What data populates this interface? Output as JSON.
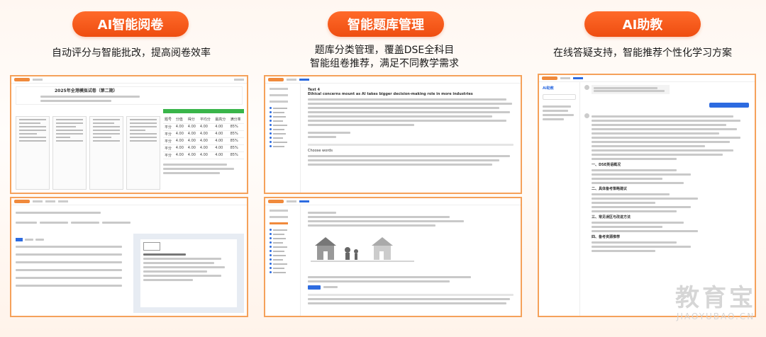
{
  "features": [
    {
      "title": "AI智能阅卷",
      "description": [
        "自动评分与智能批改，提高阅卷效率"
      ]
    },
    {
      "title": "智能题库管理",
      "description": [
        "题库分类管理，覆盖DSE全科目",
        "智能组卷推荐，满足不同教学需求"
      ]
    },
    {
      "title": "AI助教",
      "description": [
        "在线答疑支持，智能推荐个性化学习方案"
      ]
    }
  ],
  "screens": {
    "grading": {
      "exam_title": "2025年全港模拟试卷（第二期）",
      "table_headers": [
        "题号",
        "分值",
        "得分",
        "平均分",
        "最高分",
        "满分率"
      ],
      "row_label": "平分",
      "row_values": [
        "4.00",
        "4.00",
        "4.00",
        "4.00",
        "85%"
      ]
    },
    "question_bank": {
      "text_label": "Text 4",
      "heading": "Ethical concerns mount as AI takes bigger decision-making role in more industries",
      "question_type": "Choose words"
    },
    "assistant": {
      "title": "AI助教",
      "section_headers": [
        "一、DSE英语概况",
        "二、具体备考策略建议",
        "三、常见误区与改进方法",
        "四、备考资源推荐"
      ]
    }
  },
  "watermark": {
    "text": "教育宝",
    "domain": "JIAOYUBAO.CN"
  },
  "colors": {
    "accent": "#ee4d10",
    "frame": "#f5a15a",
    "ui_blue": "#2d6be0"
  }
}
